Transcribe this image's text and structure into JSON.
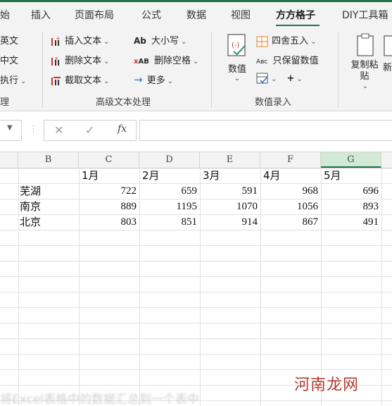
{
  "ribbon_tabs": [
    "始",
    "插入",
    "页面布局",
    "公式",
    "数据",
    "视图",
    "方方格子",
    "DIY工具箱"
  ],
  "ribbon_left_partial": [
    "英文",
    "中文",
    "执行",
    "理"
  ],
  "text_group": {
    "insert_text": "插入文本",
    "delete_text": "删除文本",
    "extract_text": "截取文本",
    "case": "大小写",
    "delete_space": "删除空格",
    "more": "更多",
    "label": "高级文本处理"
  },
  "number_group": {
    "value": "数值",
    "round": "四舍五入",
    "keep_value": "只保留数值",
    "label": "数值录入"
  },
  "copy_group": {
    "copy_paste": "复制粘贴",
    "new_partial": "新"
  },
  "formula_bar": {
    "cancel": "✕",
    "confirm": "✓",
    "fx": "fx",
    "value": ""
  },
  "columns": [
    "B",
    "C",
    "D",
    "E",
    "F",
    "G"
  ],
  "selected_column": "G",
  "sheet": {
    "months": [
      "1月",
      "2月",
      "3月",
      "4月",
      "5月"
    ],
    "rows": [
      {
        "city": "芜湖",
        "values": [
          722,
          659,
          591,
          968,
          696
        ]
      },
      {
        "city": "南京",
        "values": [
          889,
          1195,
          1070,
          1056,
          893
        ]
      },
      {
        "city": "北京",
        "values": [
          803,
          851,
          914,
          867,
          491
        ]
      }
    ]
  },
  "watermark": "河南龙网",
  "footer_caption": "将Excel表格中的数据汇总到一个表中"
}
